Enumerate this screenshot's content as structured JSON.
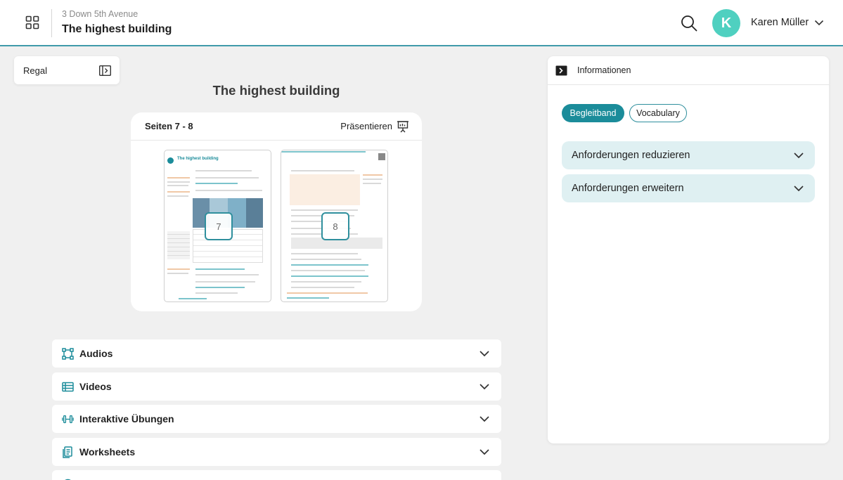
{
  "header": {
    "breadcrumb": "3 Down 5th Avenue",
    "title": "The highest building",
    "user_initial": "K",
    "user_name": "Karen Müller"
  },
  "sidebar_toggle": {
    "label": "Regal"
  },
  "main": {
    "title": "The highest building",
    "pages": {
      "label": "Seiten 7 - 8",
      "present_label": "Präsentieren",
      "left_page_number": "7",
      "right_page_number": "8",
      "left_page_heading": "The highest building"
    },
    "resources": [
      {
        "label": "Audios",
        "icon": "audio-nodes-icon"
      },
      {
        "label": "Videos",
        "icon": "video-list-icon"
      },
      {
        "label": "Interaktive Übungen",
        "icon": "dumbbell-icon"
      },
      {
        "label": "Worksheets",
        "icon": "worksheet-icon"
      }
    ]
  },
  "info_panel": {
    "title": "Informationen",
    "tabs": [
      "Begleitband",
      "Vocabulary"
    ],
    "active_tab": "Begleitband",
    "accordions": [
      "Anforderungen reduzieren",
      "Anforderungen erweitern"
    ]
  },
  "colors": {
    "accent": "#1b8c9a",
    "avatar": "#4fd0c0",
    "accordion_bg": "#dff0f2",
    "page_bg": "#f0f0f0"
  }
}
